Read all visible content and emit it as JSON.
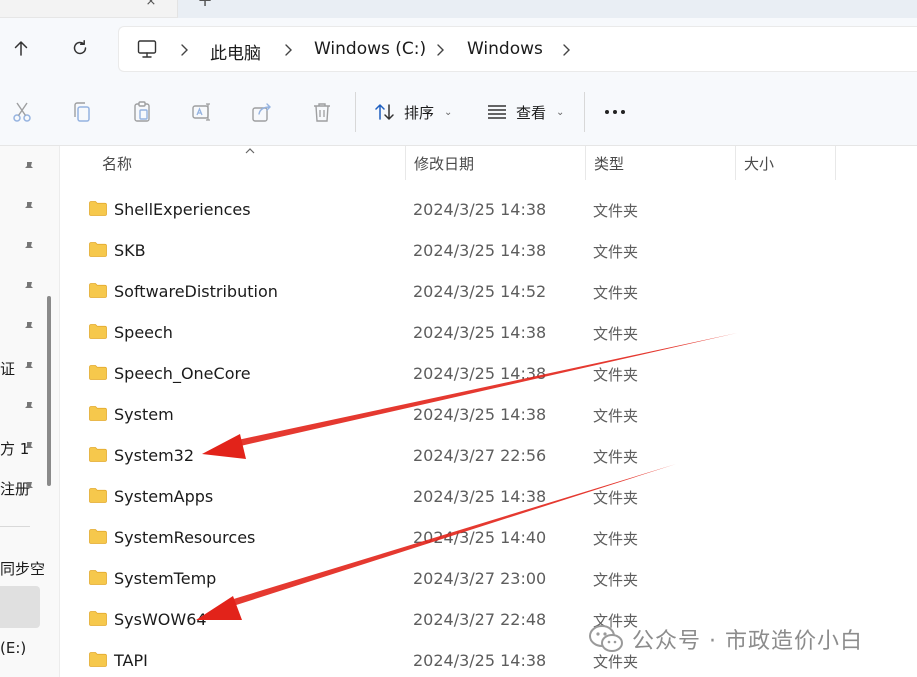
{
  "tabstrip": {
    "close_glyph": "×",
    "new_tab_glyph": "+"
  },
  "nav": {
    "up_icon": "arrow-up-icon",
    "refresh_icon": "refresh-icon"
  },
  "breadcrumb": {
    "root_icon": "monitor-icon",
    "items": [
      "此电脑",
      "Windows (C:)",
      "Windows"
    ]
  },
  "toolbar": {
    "icons": [
      "cut-icon",
      "copy-icon",
      "paste-icon",
      "rename-icon",
      "share-icon",
      "delete-icon"
    ],
    "sort_label": "排序",
    "view_label": "查看"
  },
  "sidebar": {
    "partial_labels": [
      "证",
      "方 1",
      "注册",
      "同步空",
      "(E:)"
    ]
  },
  "columns": {
    "name": "名称",
    "modified": "修改日期",
    "type": "类型",
    "size": "大小"
  },
  "files": [
    {
      "name": "ShellExperiences",
      "modified": "2024/3/25 14:38",
      "type": "文件夹"
    },
    {
      "name": "SKB",
      "modified": "2024/3/25 14:38",
      "type": "文件夹"
    },
    {
      "name": "SoftwareDistribution",
      "modified": "2024/3/25 14:52",
      "type": "文件夹"
    },
    {
      "name": "Speech",
      "modified": "2024/3/25 14:38",
      "type": "文件夹"
    },
    {
      "name": "Speech_OneCore",
      "modified": "2024/3/25 14:38",
      "type": "文件夹"
    },
    {
      "name": "System",
      "modified": "2024/3/25 14:38",
      "type": "文件夹"
    },
    {
      "name": "System32",
      "modified": "2024/3/27 22:56",
      "type": "文件夹"
    },
    {
      "name": "SystemApps",
      "modified": "2024/3/25 14:38",
      "type": "文件夹"
    },
    {
      "name": "SystemResources",
      "modified": "2024/3/25 14:40",
      "type": "文件夹"
    },
    {
      "name": "SystemTemp",
      "modified": "2024/3/27 23:00",
      "type": "文件夹"
    },
    {
      "name": "SysWOW64",
      "modified": "2024/3/27 22:48",
      "type": "文件夹"
    },
    {
      "name": "TAPI",
      "modified": "2024/3/25 14:38",
      "type": "文件夹"
    }
  ],
  "annotations": {
    "arrow_color": "#e2231a",
    "arrow_targets": [
      "System32",
      "SysWOW64"
    ]
  },
  "watermark": {
    "text": "公众号 · 市政造价小白"
  },
  "colors": {
    "folder": "#f6c84c",
    "folder_dark": "#e8b43a",
    "selection": "#e0e0e0"
  }
}
